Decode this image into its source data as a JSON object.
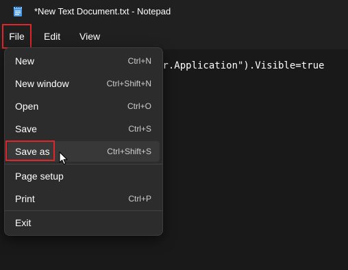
{
  "window": {
    "title": "*New Text Document.txt - Notepad",
    "icon": "notepad-icon"
  },
  "menubar": {
    "items": [
      {
        "label": "File"
      },
      {
        "label": "Edit"
      },
      {
        "label": "View"
      }
    ]
  },
  "editor": {
    "visible_text": "er.Application\").Visible=true"
  },
  "file_menu": {
    "items": [
      {
        "label": "New",
        "shortcut": "Ctrl+N"
      },
      {
        "label": "New window",
        "shortcut": "Ctrl+Shift+N"
      },
      {
        "label": "Open",
        "shortcut": "Ctrl+O"
      },
      {
        "label": "Save",
        "shortcut": "Ctrl+S"
      },
      {
        "label": "Save as",
        "shortcut": "Ctrl+Shift+S"
      },
      {
        "label": "Page setup",
        "shortcut": ""
      },
      {
        "label": "Print",
        "shortcut": "Ctrl+P"
      },
      {
        "label": "Exit",
        "shortcut": ""
      }
    ],
    "hovered": "Save as"
  },
  "colors": {
    "highlight": "#e0262b",
    "menu_bg": "#2c2c2c",
    "editor_bg": "#191919"
  }
}
